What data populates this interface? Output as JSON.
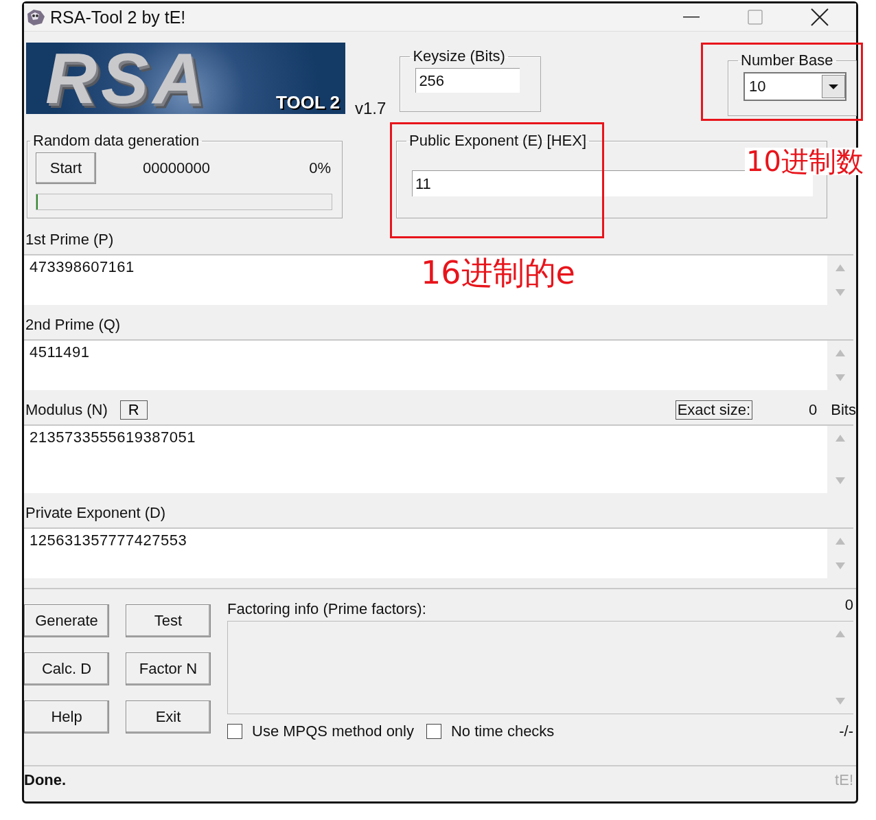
{
  "window": {
    "title": "RSA-Tool 2 by tE!"
  },
  "logo": {
    "text": "RSA",
    "subtext": "TOOL 2",
    "version": "v1.7"
  },
  "keysize": {
    "label": "Keysize (Bits)",
    "value": "256"
  },
  "number_base": {
    "label": "Number Base",
    "value": "10",
    "highlighted": true,
    "note": "10进制数"
  },
  "random_generation": {
    "label": "Random data generation",
    "button": "Start",
    "counter": "00000000",
    "percent": "0%",
    "level": 0
  },
  "public_exponent": {
    "label": "Public Exponent (E) [HEX]",
    "value": "11",
    "highlighted": true,
    "note": "16进制的e"
  },
  "fields": [
    {
      "label": "1st Prime (P)",
      "value": "473398607161",
      "kind": "plain"
    },
    {
      "label": "2nd Prime (Q)",
      "value": "4511491",
      "kind": "plain"
    },
    {
      "label": "Modulus (N)",
      "value": "2135733555619387051",
      "kind": "modulus",
      "button": "R",
      "exact_size_label": "Exact size:",
      "size": "0",
      "unit": "Bits"
    },
    {
      "label": "Private Exponent (D)",
      "value": "125631357777427553",
      "kind": "plain"
    }
  ],
  "buttons": [
    "Generate",
    "Test",
    "Calc. D",
    "Factor N",
    "Help",
    "Exit"
  ],
  "factoring": {
    "label": "Factoring info (Prime factors):",
    "count": "0"
  },
  "options": [
    {
      "label": "Use MPQS method only",
      "checked": false
    },
    {
      "label": "No time checks",
      "checked": false
    }
  ],
  "progress_text": "-/-",
  "status_bar": {
    "text": "Done.",
    "credit": "tE!"
  }
}
